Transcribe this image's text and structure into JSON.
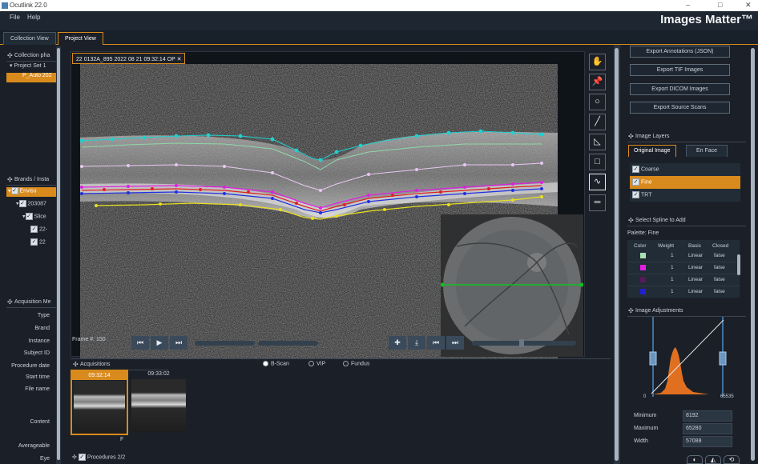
{
  "window": {
    "title": "Ocutlink 22.0",
    "min": "–",
    "max": "□",
    "close": "✕"
  },
  "menu": [
    "File",
    "Help"
  ],
  "brand": "Images Matter™",
  "tabs": [
    "Collection View",
    "Project View"
  ],
  "left": {
    "collection_header": "Collection pha",
    "project_items": [
      "Project Set 1",
      "P_Auto 202"
    ],
    "brands_header": "Brands / Insta",
    "brand_items": [
      "Envisu",
      "203087",
      "Slice",
      "22-",
      "22"
    ],
    "acq_header": "Acquisition Me",
    "acq_fields": [
      "Type",
      "Brand",
      "Instance",
      "Subject ID",
      "Procedure date",
      "Start time",
      "File name",
      "Content",
      "Averageable",
      "Eye"
    ]
  },
  "viewer": {
    "image_tab": "22 0132A_895 2022 08 21 09:32:14 OP",
    "frame_label": "Frame #:",
    "frame_value": "150"
  },
  "tools": [
    "pan-icon",
    "pin-icon",
    "circle-icon",
    "line-icon",
    "polygon-icon",
    "rectangle-icon",
    "spline-icon",
    "equals-icon"
  ],
  "acquisitions": {
    "header": "Acquisitions",
    "modes": [
      "B-Scan",
      "VIP",
      "Fundus"
    ],
    "selected_mode": "B-Scan",
    "thumbs": [
      {
        "time": "09:32:14",
        "eye": "F"
      },
      {
        "time": "09:33:02",
        "eye": ""
      }
    ]
  },
  "procedures": {
    "header": "Procedures 2/2"
  },
  "right": {
    "export_buttons": [
      "Export Annotations (JSON)",
      "Export TIF Images",
      "Export DICOM Images",
      "Export Source Scans"
    ],
    "layers_header": "Image Layers",
    "layer_tabs": [
      "Original Image",
      "En Face"
    ],
    "layers": [
      "Coarse",
      "Fine",
      "TRT"
    ],
    "selected_layer": "Fine",
    "spline_header": "Select Spline to Add",
    "palette": "Palette: Fine",
    "spline_columns": [
      "Color",
      "Weight",
      "Basis",
      "Closed"
    ],
    "spline_rows": [
      {
        "color": "#a8e0b0",
        "weight": "1",
        "basis": "Linear",
        "closed": "false"
      },
      {
        "color": "#e020e0",
        "weight": "1",
        "basis": "Linear",
        "closed": "false"
      },
      {
        "color": "#5a1a5a",
        "weight": "1",
        "basis": "Linear",
        "closed": "false"
      },
      {
        "color": "#2020d0",
        "weight": "1",
        "basis": "Linear",
        "closed": "false"
      }
    ],
    "adjust_header": "Image Adjustments",
    "hist_min_label": "0",
    "hist_max_label": "65535",
    "minimum_label": "Minimum",
    "minimum": "8192",
    "maximum_label": "Maximum",
    "maximum": "65280",
    "width_label": "Width",
    "width": "57088"
  },
  "colors": {
    "accent": "#d98a1c",
    "panel": "#1e2731",
    "cyan": "#20d0d0",
    "magenta": "#e020e0",
    "red": "#e02020",
    "blue": "#2030e0",
    "yellow": "#e8e020",
    "green": "#10c020"
  }
}
